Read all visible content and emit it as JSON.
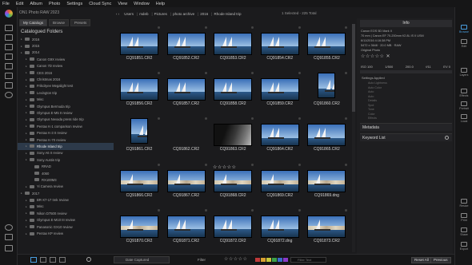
{
  "menu": [
    "File",
    "Edit",
    "Album",
    "Photo",
    "Settings",
    "Cloud Sync",
    "View",
    "Window",
    "Help"
  ],
  "app_title": "ON1 Photo RAW 2023",
  "library_tabs": [
    {
      "label": "My Catalogs",
      "active": true
    },
    {
      "label": "Browse",
      "active": false
    },
    {
      "label": "Presets",
      "active": false
    }
  ],
  "catalogued_title": "Catalogued Folders",
  "folders": [
    {
      "label": "2016",
      "level": 0,
      "sel": false
    },
    {
      "label": "2015",
      "level": 0,
      "sel": false
    },
    {
      "label": "2014",
      "level": 0,
      "sel": false
    },
    {
      "label": "Canon G9X review",
      "level": 1,
      "sel": false
    },
    {
      "label": "Canon 7D review",
      "level": 1,
      "sel": false
    },
    {
      "label": "CES 2016",
      "level": 1,
      "sel": false
    },
    {
      "label": "Christmas 2016",
      "level": 1,
      "sel": false
    },
    {
      "label": "Frikcityee Megalight test",
      "level": 1,
      "sel": false
    },
    {
      "label": "Lexington trip",
      "level": 1,
      "sel": false
    },
    {
      "label": "Misc",
      "level": 1,
      "sel": false
    },
    {
      "label": "Olympus Bermuda trip",
      "level": 1,
      "sel": false
    },
    {
      "label": "Olympus E-M5 II review",
      "level": 1,
      "sel": false
    },
    {
      "label": "Olympus Nevada press ride trip",
      "level": 1,
      "sel": false
    },
    {
      "label": "Pentax K-1 comparison review",
      "level": 1,
      "sel": false
    },
    {
      "label": "Pentax K-3 II review",
      "level": 1,
      "sel": false
    },
    {
      "label": "Pentax K-70 review",
      "level": 1,
      "sel": false
    },
    {
      "label": "Rhode Island trip",
      "level": 1,
      "sel": true
    },
    {
      "label": "Sony A6 II review",
      "level": 1,
      "sel": false
    },
    {
      "label": "Sony Austin trip",
      "level": 1,
      "sel": false
    },
    {
      "label": "RRAD",
      "level": 2,
      "sel": false
    },
    {
      "label": "4060",
      "level": 2,
      "sel": false
    },
    {
      "label": "RX100M3",
      "level": 2,
      "sel": false
    },
    {
      "label": "Yi Camera review",
      "level": 1,
      "sel": false
    },
    {
      "label": "2017",
      "level": 0,
      "sel": false
    },
    {
      "label": "BR-X7-17 trek review",
      "level": 1,
      "sel": false
    },
    {
      "label": "Misc",
      "level": 1,
      "sel": false
    },
    {
      "label": "Nikon D7500 review",
      "level": 1,
      "sel": false
    },
    {
      "label": "Olympus E-M10 III review",
      "level": 1,
      "sel": false
    },
    {
      "label": "Panasonic GX10 review",
      "level": 1,
      "sel": false
    },
    {
      "label": "Pentax KP review",
      "level": 1,
      "sel": false
    }
  ],
  "path": [
    "Users",
    "mdeb",
    "Pictures",
    "photo archive",
    "2016",
    "Rhode Island trip"
  ],
  "selection_info": "1 Selected - 225 Total",
  "thumbnails": [
    [
      "CQ91851.CR2",
      "CQ91852.CR2",
      "CQ91853.CR2",
      "CQ91854.CR2",
      "CQ91855.CR2"
    ],
    [
      "CQ91856.CR2",
      "CQ91857.CR2",
      "CQ91858.CR2",
      "CQ91859.CR2",
      "CQ91860.CR2"
    ],
    [
      "CQ91861.CR2",
      "CQ91862.CR2",
      "CQ91863.CR2",
      "CQ91864.CR2",
      "CQ91865.CR2"
    ],
    [
      "CQ91866.CR2",
      "CQ91867.CR2",
      "CQ91868.CR2",
      "CQ91869.CR2",
      "CQ91869.dng"
    ],
    [
      "CQ91870.CR2",
      "CQ91871.CR2",
      "CQ91872.CR2",
      "CQ91872.dng",
      "CQ91873.CR2"
    ]
  ],
  "info": {
    "header": "Info",
    "camera": "Canon EOS 5D Mark II",
    "lens": "70 mm | Canon EF 70-200mm f/2.8L IS II USM",
    "date": "6/11/2016 4:16:38 PM",
    "size": "5472 x 3648 · 20.0 MB · RAW",
    "original": "Original Photo",
    "exif": [
      "ISO 100",
      "1/500",
      "200.0",
      "f/11",
      "EV 0"
    ],
    "settings_applied": "Settings Applied",
    "settings_rows": [
      "Auto Lightness",
      "Auto Color",
      "Auto",
      "Auto",
      "Details",
      "Spot",
      "Tone",
      "Color",
      "Effects"
    ],
    "metadata": "Metadata",
    "keyword_list": "Keyword List"
  },
  "right_tools": [
    {
      "label": "Browse",
      "active": true
    },
    {
      "label": "Edit",
      "active": false
    },
    {
      "label": "Layers",
      "active": false
    },
    {
      "label": "Effects",
      "active": false
    },
    {
      "label": "Portrait",
      "active": false
    },
    {
      "label": "Local",
      "active": false
    },
    {
      "label": "Resize",
      "active": false
    },
    {
      "label": "Print",
      "active": false
    },
    {
      "label": "Share",
      "active": false
    },
    {
      "label": "Export",
      "active": false
    }
  ],
  "bottom": {
    "sort_label": "Date Captured",
    "filter_label": "Filter",
    "filter_placeholder": "Filter Text",
    "reset_all": "Reset All",
    "previous": "Previous"
  },
  "colors": {
    "accent": "#4a9fe0",
    "selected_folder": "#2d3a4a",
    "swatches": [
      "#c03a3a",
      "#d8a030",
      "#c8c83a",
      "#3aa04a",
      "#3a6ac8",
      "#8a3ac8"
    ]
  }
}
